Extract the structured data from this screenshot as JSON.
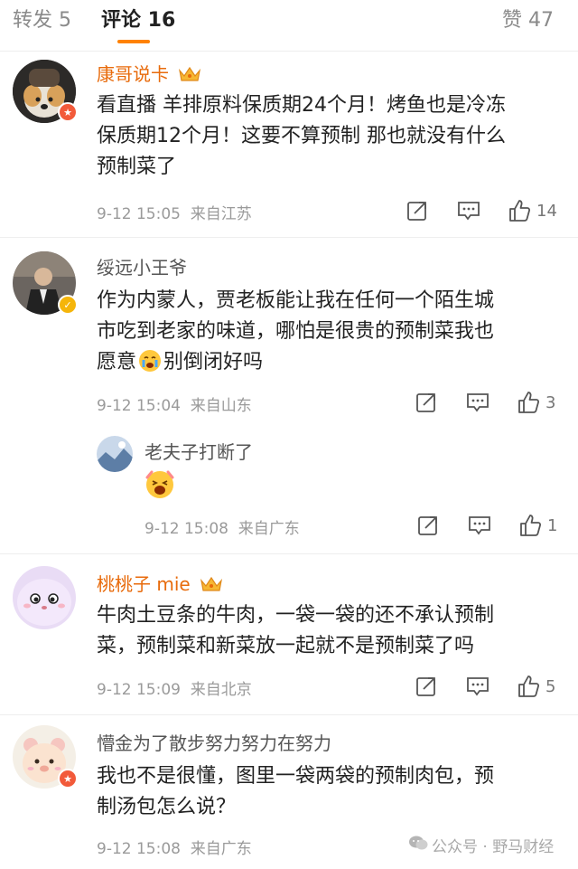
{
  "tabs": [
    {
      "label": "转发 5"
    },
    {
      "label": "评论 16"
    },
    {
      "label": "赞 47"
    }
  ],
  "accent_color": "#ff8200",
  "vip_name_color": "#e86b0c",
  "comments": [
    {
      "user": "康哥说卡",
      "badge": "crown-vip",
      "text": [
        "看直播 羊排原料保质期24个月！烤鱼也是冷冻",
        "保质期12个月！这要不算预制 那也就没有什么",
        "预制菜了"
      ],
      "time": "9-12 15:05",
      "location": "来自江苏",
      "likes": "14"
    },
    {
      "user": "绥远小王爷",
      "text": [
        "作为内蒙人，贾老板能让我在任何一个陌生城",
        "市吃到老家的味道，哪怕是很贵的预制菜我也",
        "愿意",
        "别倒闭好吗"
      ],
      "time": "9-12 15:04",
      "location": "来自山东",
      "likes": "3",
      "reply": {
        "user": "老夫子打断了",
        "time": "9-12 15:08",
        "location": "来自广东",
        "likes": "1"
      }
    },
    {
      "user": "桃桃子 mie",
      "badge": "crown-vip",
      "text": [
        "牛肉土豆条的牛肉，一袋一袋的还不承认预制",
        "菜，预制菜和新菜放一起就不是预制菜了吗"
      ],
      "time": "9-12 15:09",
      "location": "来自北京",
      "likes": "5"
    },
    {
      "user": "懵金为了散步努力努力在努力",
      "text": [
        "我也不是很懂，图里一袋两袋的预制肉包，预",
        "制汤包怎么说？"
      ],
      "time": "9-12 15:08",
      "location": "来自广东"
    }
  ],
  "watermark": "公众号 · 野马财经"
}
